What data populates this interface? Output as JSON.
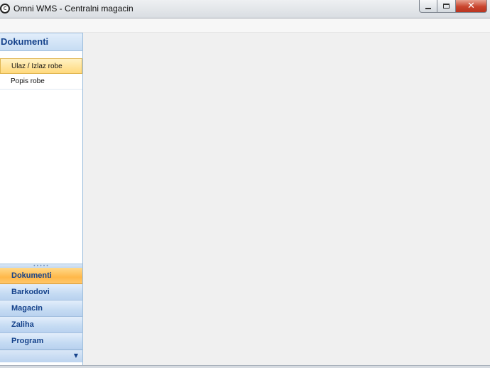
{
  "window": {
    "title": "Omni WMS - Centralni magacin",
    "icon": "omni-logo-icon",
    "controls": {
      "minimize": "minimize-icon",
      "maximize": "maximize-icon",
      "close": "✕"
    }
  },
  "nav": {
    "header": "Dokumenti",
    "items": [
      {
        "label": "Ulaz / Izlaz robe",
        "selected": true
      },
      {
        "label": "Popis robe",
        "selected": false
      }
    ],
    "buttons": [
      {
        "label": "Dokumenti",
        "active": true
      },
      {
        "label": "Barkodovi",
        "active": false
      },
      {
        "label": "Magacin",
        "active": false
      },
      {
        "label": "Zaliha",
        "active": false
      },
      {
        "label": "Program",
        "active": false
      }
    ],
    "overflow_icon": "chevron-down-icon"
  },
  "colors": {
    "accent": "#15428b",
    "selected": "#ffd97c",
    "active_pane": "#ffb84a",
    "close_button": "#c9452e"
  }
}
